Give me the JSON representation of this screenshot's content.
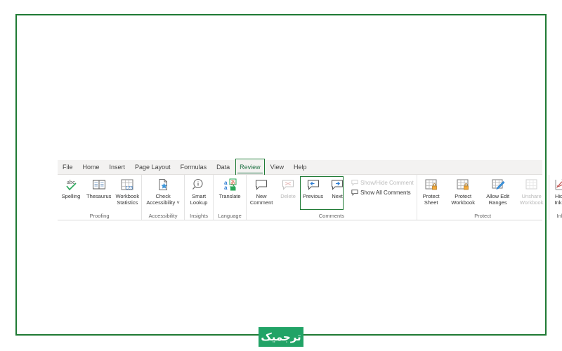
{
  "frame": {
    "border_color": "#1f7a34"
  },
  "ribbon": {
    "tabs": [
      {
        "label": "File",
        "active": false
      },
      {
        "label": "Home",
        "active": false
      },
      {
        "label": "Insert",
        "active": false
      },
      {
        "label": "Page Layout",
        "active": false
      },
      {
        "label": "Formulas",
        "active": false
      },
      {
        "label": "Data",
        "active": false
      },
      {
        "label": "Review",
        "active": true
      },
      {
        "label": "View",
        "active": false
      },
      {
        "label": "Help",
        "active": false
      }
    ],
    "highlight_color": "#1f7a34",
    "active_tab": "Review",
    "groups": [
      {
        "name": "proofing",
        "label": "Proofing",
        "buttons": [
          {
            "label": "Spelling",
            "icon": "abc-check-icon",
            "disabled": false
          },
          {
            "label": "Thesaurus",
            "icon": "book-icon",
            "disabled": false
          },
          {
            "label": "Workbook\nStatistics",
            "icon": "grid-123-icon",
            "disabled": false
          }
        ]
      },
      {
        "name": "accessibility",
        "label": "Accessibility",
        "buttons": [
          {
            "label": "Check\nAccessibility ˅",
            "icon": "document-star-icon",
            "disabled": false
          }
        ]
      },
      {
        "name": "insights",
        "label": "Insights",
        "buttons": [
          {
            "label": "Smart\nLookup",
            "icon": "magnifier-info-icon",
            "disabled": false
          }
        ]
      },
      {
        "name": "language",
        "label": "Language",
        "buttons": [
          {
            "label": "Translate",
            "icon": "translate-icon",
            "disabled": false
          }
        ]
      },
      {
        "name": "comments",
        "label": "Comments",
        "buttons": [
          {
            "label": "New\nComment",
            "icon": "new-comment-icon",
            "disabled": false
          },
          {
            "label": "Delete",
            "icon": "delete-comment-icon",
            "disabled": true
          },
          {
            "label": "Previous",
            "icon": "previous-comment-icon",
            "disabled": false,
            "highlighted": true
          },
          {
            "label": "Next",
            "icon": "next-comment-icon",
            "disabled": false,
            "highlighted": true
          }
        ],
        "small_buttons": [
          {
            "label": "Show/Hide Comment",
            "icon": "show-hide-comment-icon",
            "disabled": true
          },
          {
            "label": "Show All Comments",
            "icon": "show-all-comments-icon",
            "disabled": false
          }
        ]
      },
      {
        "name": "protect",
        "label": "Protect",
        "buttons": [
          {
            "label": "Protect\nSheet",
            "icon": "protect-sheet-icon",
            "disabled": false
          },
          {
            "label": "Protect\nWorkbook",
            "icon": "protect-workbook-icon",
            "disabled": false
          },
          {
            "label": "Allow Edit\nRanges",
            "icon": "allow-edit-ranges-icon",
            "disabled": false
          },
          {
            "label": "Unshare\nWorkbook",
            "icon": "unshare-workbook-icon",
            "disabled": true
          }
        ]
      },
      {
        "name": "ink",
        "label": "Ink",
        "buttons": [
          {
            "label": "Hide\nInk ˅",
            "icon": "hide-ink-icon",
            "disabled": false
          }
        ]
      }
    ]
  },
  "logo": {
    "text": "ترجمیک",
    "background": "#21a366",
    "color": "#ffffff"
  }
}
